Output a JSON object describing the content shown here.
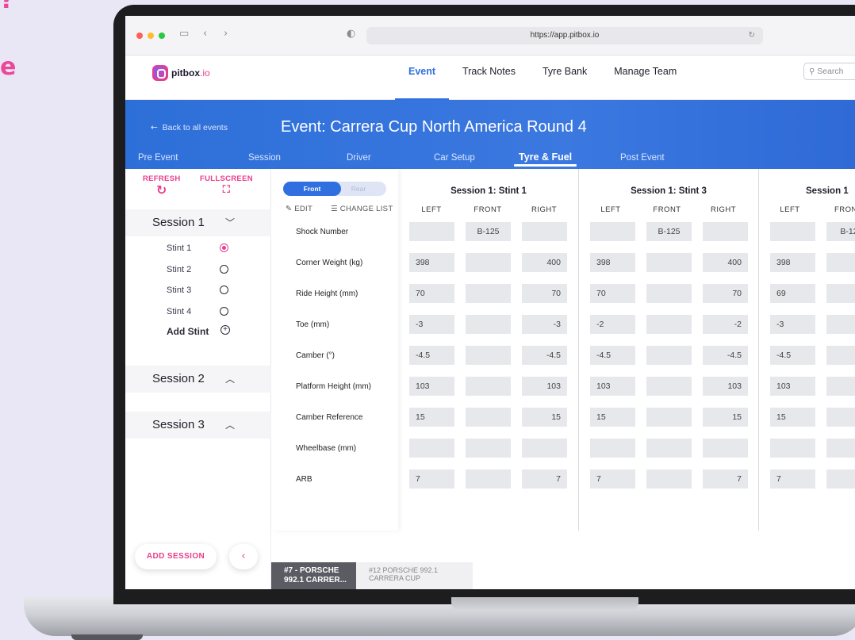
{
  "decor": {
    "line1": "?",
    "line2": "e"
  },
  "browser": {
    "url": "https://app.pitbox.io"
  },
  "app": {
    "logo": {
      "name": "pitbox",
      "suffix": ".io"
    },
    "nav": [
      {
        "label": "Event",
        "active": true
      },
      {
        "label": "Track Notes",
        "active": false
      },
      {
        "label": "Tyre Bank",
        "active": false
      },
      {
        "label": "Manage Team",
        "active": false
      }
    ],
    "search_placeholder": "Search"
  },
  "banner": {
    "back_label": "Back to all events",
    "title": "Event: Carrera Cup North America Round 4",
    "tabs": [
      {
        "label": "Pre Event",
        "active": false
      },
      {
        "label": "Session",
        "active": false
      },
      {
        "label": "Driver",
        "active": false
      },
      {
        "label": "Car Setup",
        "active": false
      },
      {
        "label": "Tyre & Fuel",
        "active": true
      },
      {
        "label": "Post Event",
        "active": false
      }
    ]
  },
  "sidebar": {
    "refresh_label": "REFRESH",
    "fullscreen_label": "FULLSCREEN",
    "sessions": [
      {
        "label": "Session 1",
        "expanded": true,
        "stints": [
          {
            "label": "Stint 1",
            "selected": true
          },
          {
            "label": "Stint 2",
            "selected": false
          },
          {
            "label": "Stint 3",
            "selected": false
          },
          {
            "label": "Stint 4",
            "selected": false
          }
        ],
        "add_stint_label": "Add Stint"
      },
      {
        "label": "Session 2",
        "expanded": false
      },
      {
        "label": "Session 3",
        "expanded": false
      }
    ],
    "add_session_label": "ADD SESSION"
  },
  "params_panel": {
    "toggle": {
      "front": "Front",
      "rear": "Rear",
      "selected": "Front"
    },
    "edit_label": "EDIT",
    "change_list_label": "CHANGE LIST",
    "rows": [
      "Shock Number",
      "Corner Weight (kg)",
      "Ride Height (mm)",
      "Toe (mm)",
      "Camber (°)",
      "Platform Height (mm)",
      "Camber Reference",
      "Wheelbase (mm)",
      "ARB"
    ]
  },
  "stints_table": {
    "columns": [
      "LEFT",
      "FRONT",
      "RIGHT"
    ],
    "stints": [
      {
        "title": "Session 1: Stint 1",
        "values": [
          [
            "",
            "B-125",
            ""
          ],
          [
            "398",
            "",
            "400"
          ],
          [
            "70",
            "",
            "70"
          ],
          [
            "-3",
            "",
            "-3"
          ],
          [
            "-4.5",
            "",
            "-4.5"
          ],
          [
            "103",
            "",
            "103"
          ],
          [
            "15",
            "",
            "15"
          ],
          [
            "",
            "",
            ""
          ],
          [
            "7",
            "",
            "7"
          ]
        ]
      },
      {
        "title": "Session 1: Stint 3",
        "values": [
          [
            "",
            "B-125",
            ""
          ],
          [
            "398",
            "",
            "400"
          ],
          [
            "70",
            "",
            "70"
          ],
          [
            "-2",
            "",
            "-2"
          ],
          [
            "-4.5",
            "",
            "-4.5"
          ],
          [
            "103",
            "",
            "103"
          ],
          [
            "15",
            "",
            "15"
          ],
          [
            "",
            "",
            ""
          ],
          [
            "7",
            "",
            "7"
          ]
        ]
      },
      {
        "title": "Session 1",
        "column_labels": [
          "LEFT",
          "FRON"
        ],
        "values": [
          [
            "",
            "B-12"
          ],
          [
            "398",
            ""
          ],
          [
            "69",
            ""
          ],
          [
            "-3",
            ""
          ],
          [
            "-4.5",
            ""
          ],
          [
            "103",
            ""
          ],
          [
            "15",
            ""
          ],
          [
            "",
            ""
          ],
          [
            "7",
            ""
          ]
        ]
      }
    ]
  },
  "car_tabs": [
    {
      "line1": "#7 - PORSCHE",
      "line2": "992.1 CARRER...",
      "active": true
    },
    {
      "line1": "#12 PORSCHE 992.1",
      "line2": "CARRERA CUP",
      "active": false
    }
  ]
}
